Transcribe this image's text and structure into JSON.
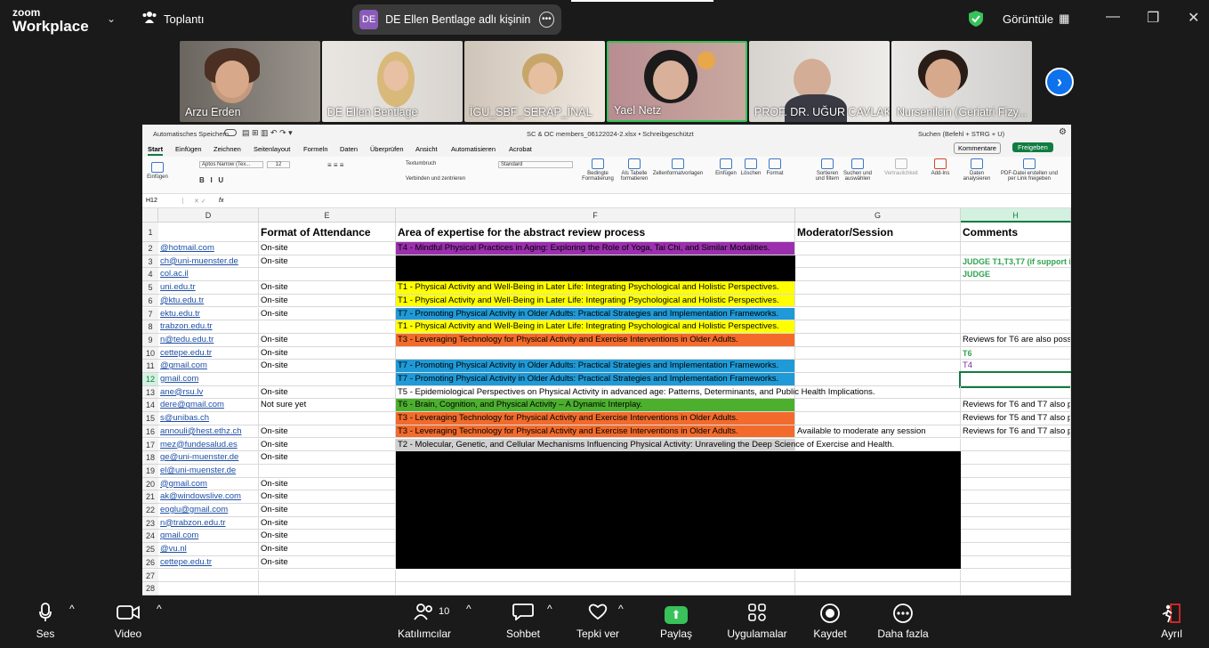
{
  "app": {
    "logo_line1": "zoom",
    "logo_line2": "Workplace",
    "meeting_label": "Toplantı",
    "share_badge": "DE",
    "share_text": "DE Ellen Bentlage adlı kişinin ekra",
    "view_label": "Görüntüle"
  },
  "participants": [
    {
      "name": "Arzu Erden"
    },
    {
      "name": "DE Ellen Bentlage"
    },
    {
      "name": "İGU_SBF_SERAP_İNAL"
    },
    {
      "name": "Yael Netz"
    },
    {
      "name": "PROF. DR. UĞUR CAVLAK"
    },
    {
      "name": "Nursenilcin (Geriatri Fizy..."
    }
  ],
  "excel": {
    "autosave": "Automatisches Speichern",
    "filename": "SC & OC members_06122024-2.xlsx • Schreibgeschützt",
    "search": "Suchen (Befehl + STRG + U)",
    "comments_btn": "Kommentare",
    "share_btn": "Freigeben",
    "tabs": [
      "Start",
      "Einfügen",
      "Zeichnen",
      "Seitenlayout",
      "Formeln",
      "Daten",
      "Überprüfen",
      "Ansicht",
      "Automatisieren",
      "Acrobat"
    ],
    "ribbon": {
      "paste": "Einfügen",
      "font": "Aptos Narrow (Tex...",
      "size": "12",
      "wrap": "Textumbruch",
      "merge": "Verbinden und zentrieren",
      "numfmt": "Standard",
      "cond": "Bedingte Formatierung",
      "table": "Als Tabelle formatieren",
      "cellstyles": "Zellenformatvorlagen",
      "insert": "Einfügen",
      "delete": "Löschen",
      "format": "Format",
      "sort": "Sortieren und filtern",
      "find": "Suchen und auswählen",
      "sensitivity": "Vertraulichkeit",
      "addins": "Add-Ins",
      "analyze": "Daten analysieren",
      "pdf": "PDF-Datei erstellen und per Link freigeben"
    },
    "namebox": "H12",
    "fx": "fx",
    "columns": [
      "D",
      "E",
      "F",
      "G",
      "H"
    ],
    "headers": {
      "E": "Format of Attendance",
      "F": "Area of expertise for the abstract review process",
      "G": "Moderator/Session",
      "H": "Comments"
    },
    "rows": [
      {
        "n": "1"
      },
      {
        "n": "2",
        "d": "@hotmail.com",
        "e": "On-site",
        "f": "T4 - Mindful Physical Practices in Aging: Exploring the Role of Yoga, Tai Chi, and Similar Modalities."
      },
      {
        "n": "3",
        "d": "ch@uni-muenster.de",
        "e": "On-site",
        "h": "JUDGE T1,T3,T7 (if support is"
      },
      {
        "n": "4",
        "d": "col.ac.il",
        "h": "JUDGE"
      },
      {
        "n": "5",
        "d": "uni.edu.tr",
        "e": "On-site",
        "f": "T1 - Physical Activity and Well-Being in Later Life: Integrating Psychological and Holistic Perspectives."
      },
      {
        "n": "6",
        "d": "@ktu.edu.tr",
        "e": "On-site",
        "f": "T1 - Physical Activity and Well-Being in Later Life: Integrating Psychological and Holistic Perspectives."
      },
      {
        "n": "7",
        "d": "ektu.edu.tr",
        "e": "On-site",
        "f": "T7 - Promoting Physical Activity in Older Adults: Practical Strategies and Implementation Frameworks."
      },
      {
        "n": "8",
        "d": "trabzon.edu.tr",
        "f": "T1 - Physical Activity and Well-Being in Later Life: Integrating Psychological and Holistic Perspectives."
      },
      {
        "n": "9",
        "d": "n@tedu.edu.tr",
        "e": "On-site",
        "f": "T3 - Leveraging Technology for Physical Activity and Exercise Interventions in Older Adults.",
        "h": "Reviews for T6 are also possi"
      },
      {
        "n": "10",
        "d": "cettepe.edu.tr",
        "e": "On-site",
        "h": "T6"
      },
      {
        "n": "11",
        "d": "@gmail.com",
        "e": "On-site",
        "f": "T7 - Promoting Physical Activity in Older Adults: Practical Strategies and Implementation Frameworks.",
        "h": "T4"
      },
      {
        "n": "12",
        "d": "gmail.com",
        "f": "T7 - Promoting Physical Activity in Older Adults: Practical Strategies and Implementation Frameworks."
      },
      {
        "n": "13",
        "d": "ane@rsu.lv",
        "e": "On-site",
        "f": "T5 - Epidemiological Perspectives on Physical Activity in advanced age: Patterns, Determinants, and Public Health Implications."
      },
      {
        "n": "14",
        "d": "dere@gmail.com",
        "e": "Not sure yet",
        "f": "T6 - Brain, Cognition, and Physical Activity – A Dynamic Interplay.",
        "h": "Reviews for T6 and T7 also pe"
      },
      {
        "n": "15",
        "d": "s@unibas.ch",
        "f": "T3 - Leveraging Technology for Physical Activity and Exercise Interventions in Older Adults.",
        "h": "Reviews for T5 and T7 also pe"
      },
      {
        "n": "16",
        "d": "annouli@hest.ethz.ch",
        "e": "On-site",
        "f": "T3 - Leveraging Technology for Physical Activity and Exercise Interventions in Older Adults.",
        "g": "Available to moderate any session",
        "h": "Reviews for T6 and T7 also pe"
      },
      {
        "n": "17",
        "d": "mez@fundesalud.es",
        "e": "On-site",
        "f": "T2 - Molecular, Genetic, and Cellular Mechanisms Influencing Physical Activity: Unraveling the Deep Science of Exercise and Health."
      },
      {
        "n": "18",
        "d": "ge@uni-muenster.de",
        "e": "On-site"
      },
      {
        "n": "19",
        "d": "el@uni-muenster.de"
      },
      {
        "n": "20",
        "d": "@gmail.com",
        "e": "On-site"
      },
      {
        "n": "21",
        "d": "ak@windowslive.com",
        "e": "On-site"
      },
      {
        "n": "22",
        "d": "eoglu@gmail.com",
        "e": "On-site"
      },
      {
        "n": "23",
        "d": "n@trabzon.edu.tr",
        "e": "On-site"
      },
      {
        "n": "24",
        "d": "gmail.com",
        "e": "On-site"
      },
      {
        "n": "25",
        "d": "@vu.nl",
        "e": "On-site"
      },
      {
        "n": "26",
        "d": "cettepe.edu.tr",
        "e": "On-site"
      },
      {
        "n": "27"
      },
      {
        "n": "28"
      }
    ]
  },
  "toolbar": {
    "audio": "Ses",
    "video": "Video",
    "participants": "Katılımcılar",
    "participant_count": "10",
    "chat": "Sohbet",
    "react": "Tepki ver",
    "share": "Paylaş",
    "apps": "Uygulamalar",
    "record": "Kaydet",
    "more": "Daha fazla",
    "leave": "Ayrıl"
  },
  "colors": {
    "purple": "#9b2fae",
    "yellow": "#ffff00",
    "blue": "#1f9ad6",
    "orange": "#f26b2c",
    "green": "#4caf2e",
    "gray": "#d0d0d0",
    "zoom_blue": "#0e72ed",
    "share_green": "#37c25a"
  }
}
